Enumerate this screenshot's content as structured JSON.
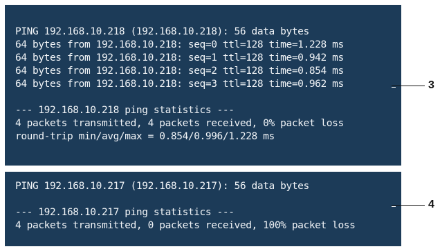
{
  "terminals": [
    {
      "lines": [
        "PING 192.168.10.218 (192.168.10.218): 56 data bytes",
        "64 bytes from 192.168.10.218: seq=0 ttl=128 time=1.228 ms",
        "64 bytes from 192.168.10.218: seq=1 ttl=128 time=0.942 ms",
        "64 bytes from 192.168.10.218: seq=2 ttl=128 time=0.854 ms",
        "64 bytes from 192.168.10.218: seq=3 ttl=128 time=0.962 ms",
        "",
        "--- 192.168.10.218 ping statistics ---",
        "4 packets transmitted, 4 packets received, 0% packet loss",
        "round-trip min/avg/max = 0.854/0.996/1.228 ms"
      ],
      "callout": "3"
    },
    {
      "lines": [
        "PING 192.168.10.217 (192.168.10.217): 56 data bytes",
        "",
        "--- 192.168.10.217 ping statistics ---",
        "4 packets transmitted, 0 packets received, 100% packet loss"
      ],
      "callout": "4"
    }
  ],
  "colors": {
    "terminal_bg": "#1c3b58",
    "terminal_text": "#f1f4f7",
    "callout": "#111111"
  }
}
